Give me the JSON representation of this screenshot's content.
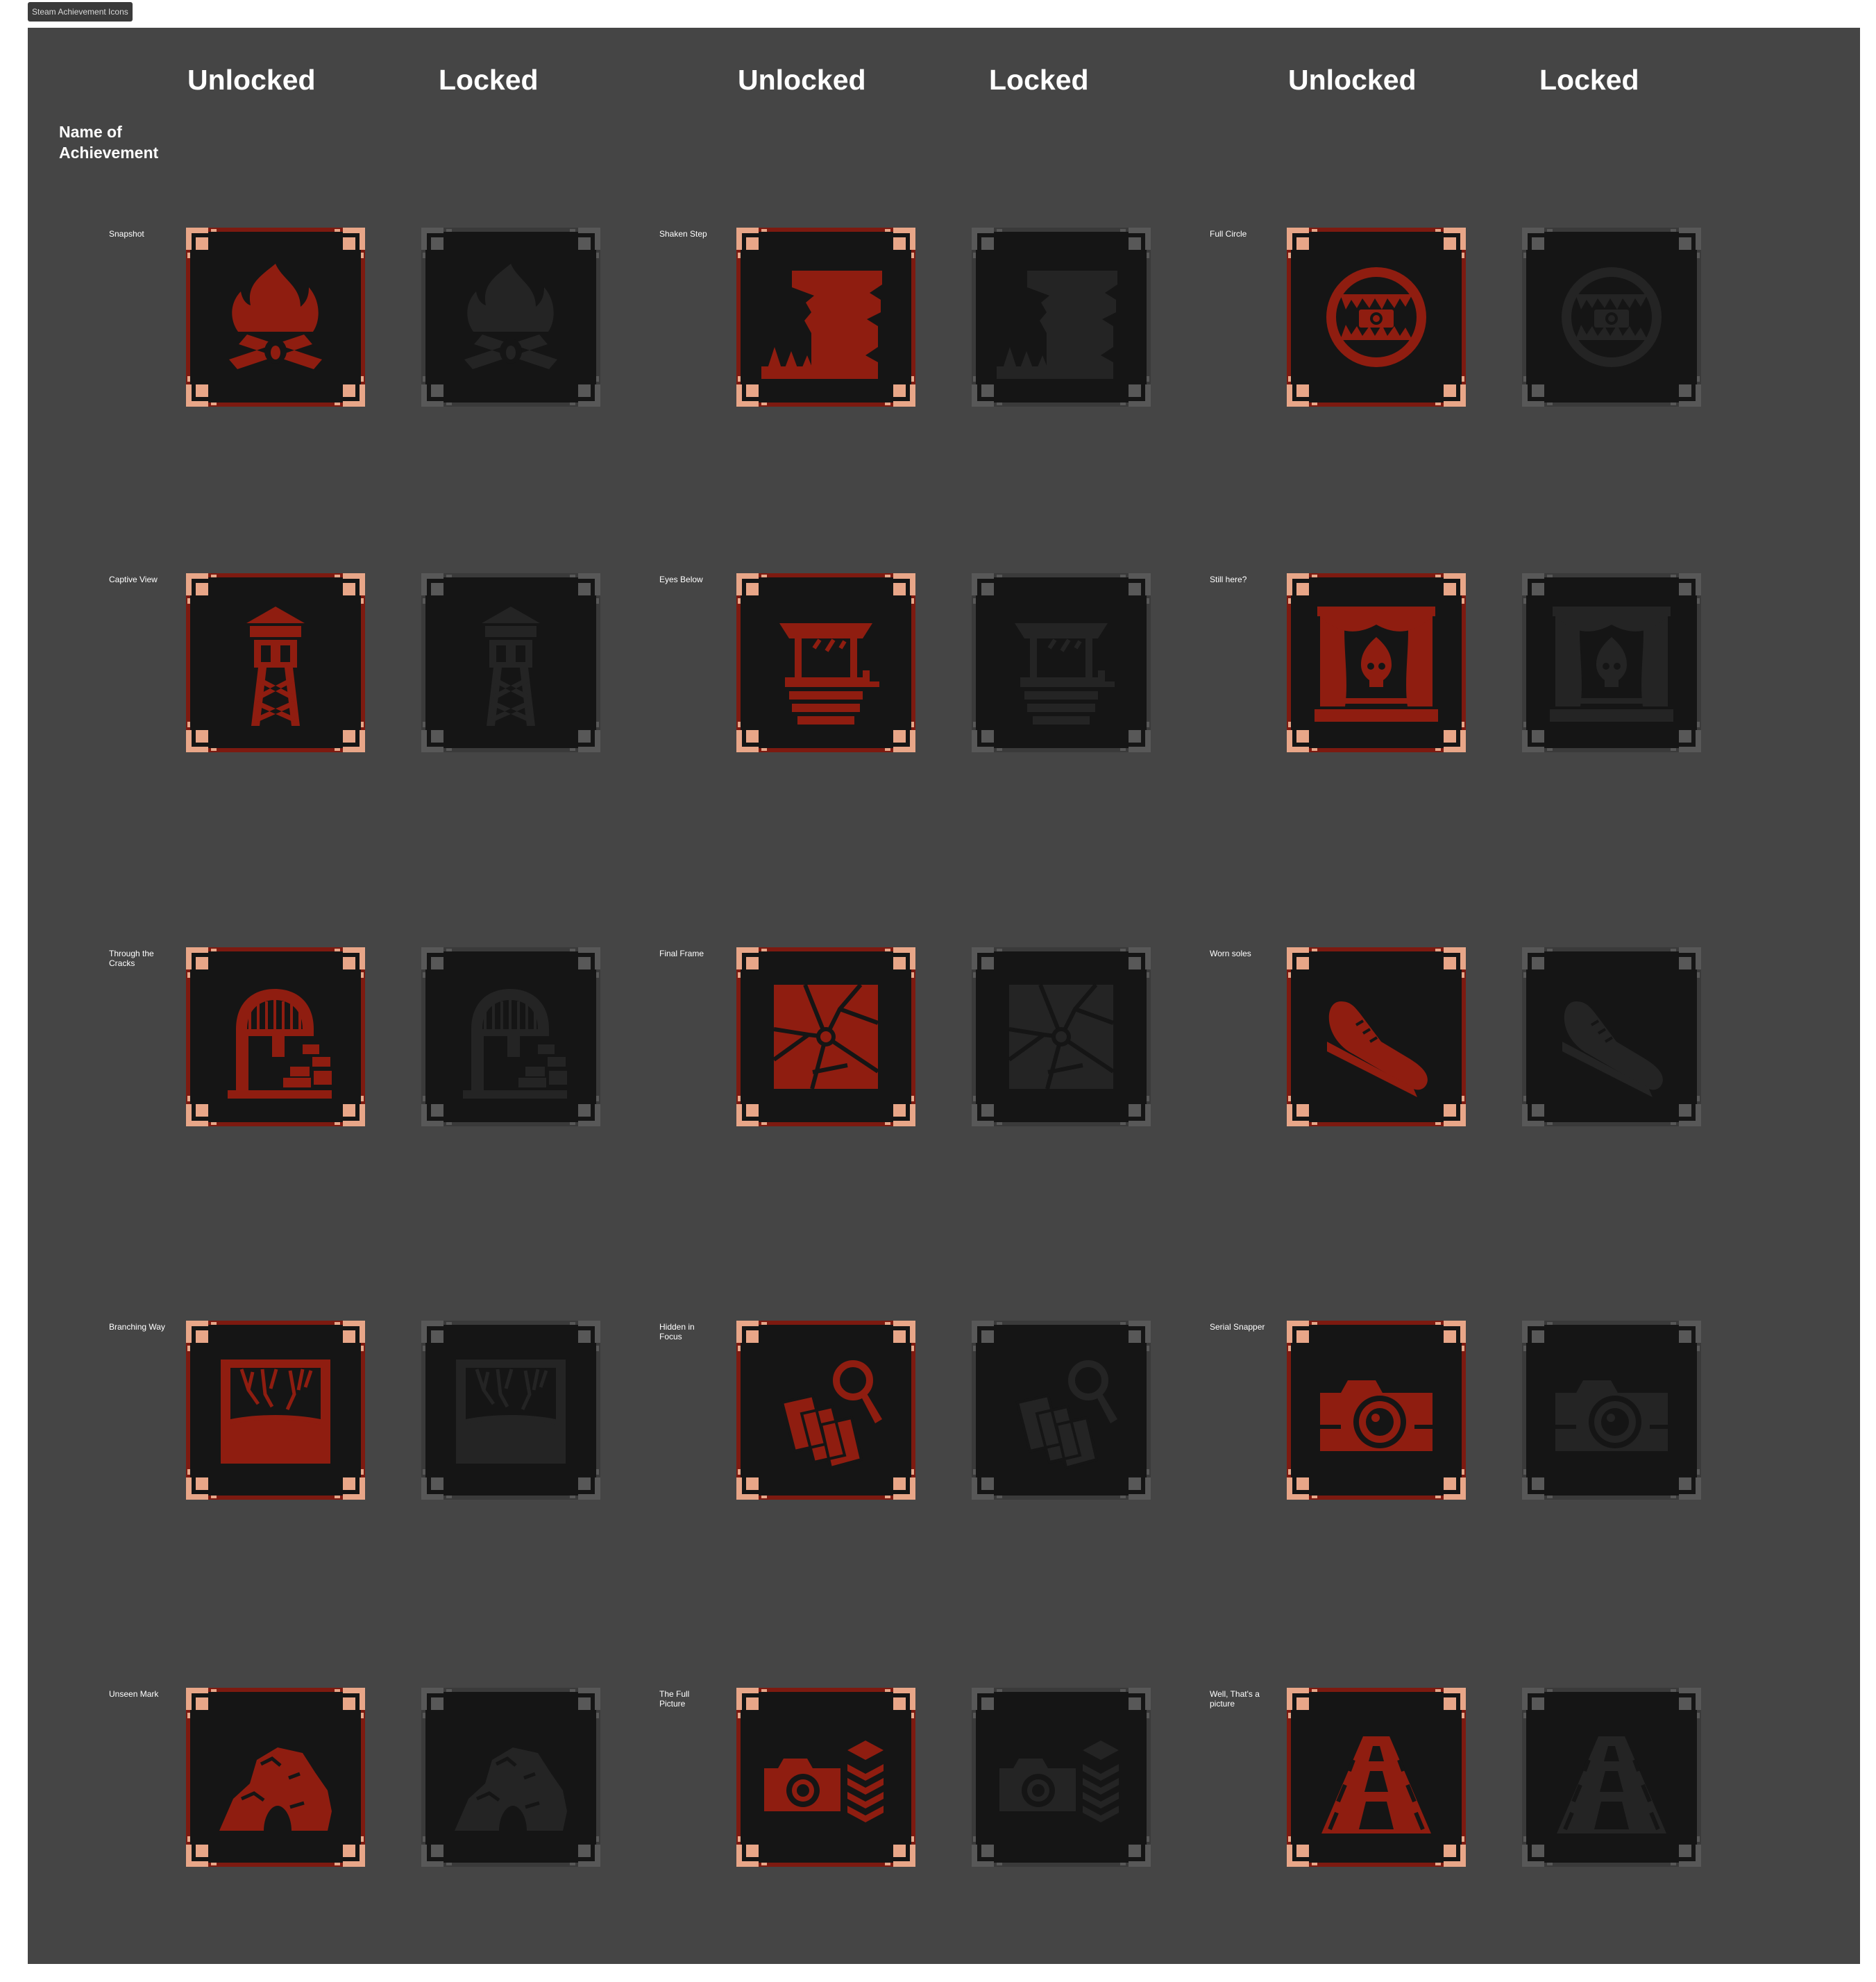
{
  "frame_label": "Steam Achievement Icons",
  "headers": {
    "name_column": "Name of Achievement",
    "state_columns": [
      "Unlocked",
      "Locked",
      "Unlocked",
      "Locked",
      "Unlocked",
      "Locked"
    ]
  },
  "colors": {
    "canvas": "#454545",
    "tile": "#151515",
    "unlocked_border": "#7d1a10",
    "unlocked_corner": "#e8a688",
    "unlocked_icon": "#8f1d10",
    "locked_border": "#3a3a3a",
    "locked_corner": "#585858",
    "locked_icon": "#242424"
  },
  "rows": [
    {
      "achievements": [
        {
          "name": "Snapshot",
          "icon": "campfire-icon"
        },
        {
          "name": "Shaken Step",
          "icon": "cliff-forest-icon"
        },
        {
          "name": "Full Circle",
          "icon": "fanged-camera-icon"
        }
      ]
    },
    {
      "achievements": [
        {
          "name": "Captive View",
          "icon": "watchtower-icon"
        },
        {
          "name": "Eyes Below",
          "icon": "wishing-well-icon"
        },
        {
          "name": "Still here?",
          "icon": "theater-skull-icon"
        }
      ]
    },
    {
      "achievements": [
        {
          "name": "Through the Cracks",
          "icon": "ruined-arch-icon"
        },
        {
          "name": "Final Frame",
          "icon": "shattered-frame-icon"
        },
        {
          "name": "Worn soles",
          "icon": "sneaker-icon"
        }
      ]
    },
    {
      "achievements": [
        {
          "name": "Branching Way",
          "icon": "branching-roots-icon"
        },
        {
          "name": "Hidden in Focus",
          "icon": "photos-magnifier-icon"
        },
        {
          "name": "Serial Snapper",
          "icon": "camera-icon"
        }
      ]
    },
    {
      "achievements": [
        {
          "name": "Unseen Mark",
          "icon": "rock-cave-icon"
        },
        {
          "name": "The Full Picture",
          "icon": "camera-stack-icon"
        },
        {
          "name": "Well, That's a picture",
          "icon": "road-perspective-icon"
        }
      ]
    }
  ]
}
